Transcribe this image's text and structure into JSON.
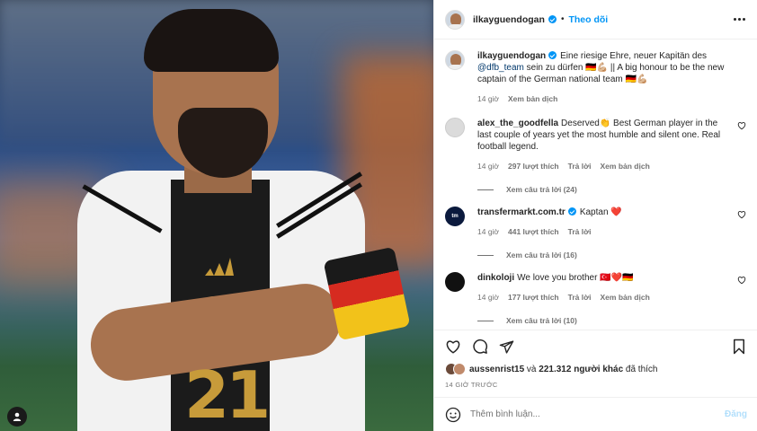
{
  "post": {
    "username": "ilkayguendogan",
    "follow_label": "Theo dõi",
    "dot": "•",
    "jersey_number": "21"
  },
  "caption": {
    "username": "ilkayguendogan",
    "text_part1": "Eine riesige Ehre, neuer Kapitän des ",
    "mention": "@dfb_team",
    "text_part2": " sein zu dürfen 🇩🇪💪🏼 || A big honour to be the new captain of the German national team 🇩🇪💪🏼",
    "time": "14 giờ",
    "translate_label": "Xem bản dịch"
  },
  "comments": [
    {
      "username": "alex_the_goodfella",
      "text": "Deserved👏 Best German player in the last couple of years yet the most humble and silent one. Real football legend.",
      "time": "14 giờ",
      "likes": "297 lượt thích",
      "reply_label": "Trả lời",
      "translate_label": "Xem bản dịch",
      "view_replies": "Xem câu trả lời (24)"
    },
    {
      "username": "transfermarkt.com.tr",
      "text": "Kaptan ❤️",
      "time": "14 giờ",
      "likes": "441 lượt thích",
      "reply_label": "Trả lời",
      "view_replies": "Xem câu trả lời (16)"
    },
    {
      "username": "dinkoloji",
      "text": "We love you brother 🇹🇷❤️🇩🇪",
      "time": "14 giờ",
      "likes": "177 lượt thích",
      "reply_label": "Trả lời",
      "translate_label": "Xem bản dịch",
      "view_replies": "Xem câu trả lời (10)"
    }
  ],
  "likes_line": {
    "first_user": "aussenrist15",
    "connector": " và ",
    "others": "221.312 người khác",
    "suffix": " đã thích"
  },
  "post_time": "14 GIỜ TRƯỚC",
  "comment_box": {
    "placeholder": "Thêm bình luận...",
    "post_label": "Đăng"
  },
  "colors": {
    "accent": "#0095f6",
    "heart_red": "#ed4956",
    "muted": "#737373"
  }
}
